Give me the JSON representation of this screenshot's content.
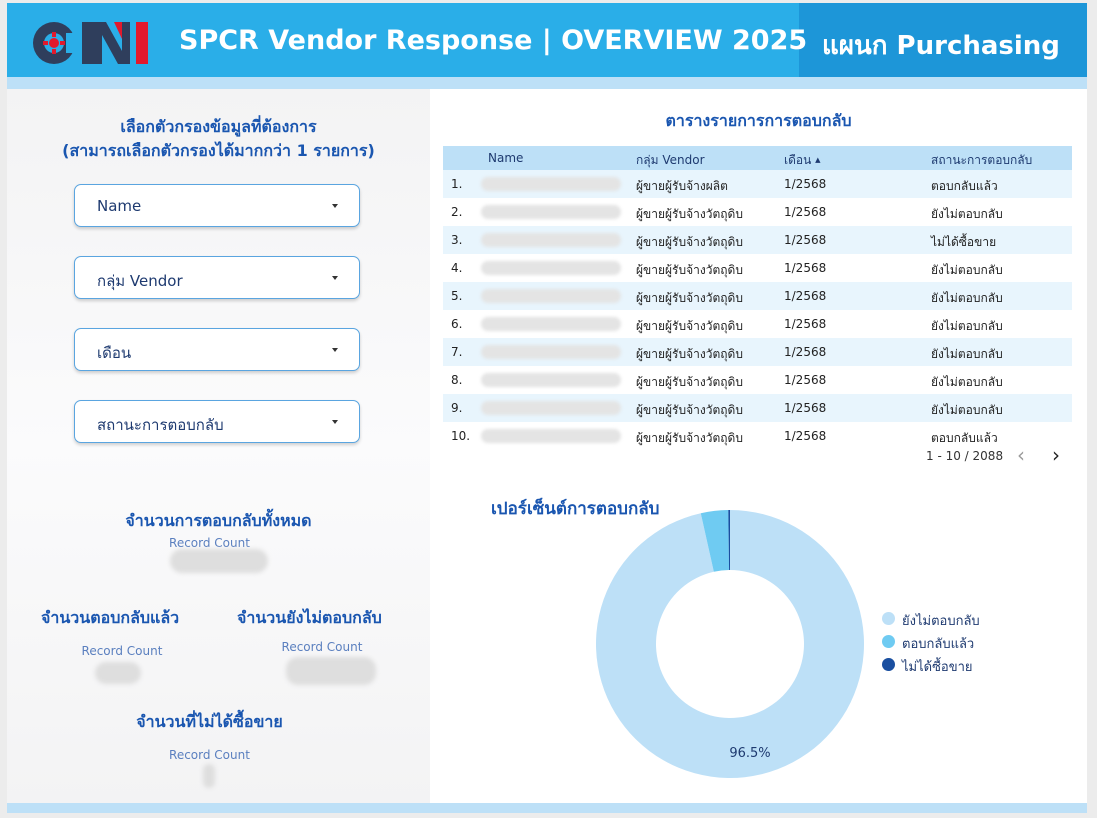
{
  "header": {
    "logo_text": "CNI",
    "title": "SPCR Vendor Response | OVERVIEW 2025",
    "department": "แผนก Purchasing"
  },
  "filters": {
    "title_line1": "เลือกตัวกรองข้อมูลที่ต้องการ",
    "title_line2": "(สามารถเลือกตัวกรองได้มากกว่า 1 รายการ)",
    "items": [
      {
        "label": "Name"
      },
      {
        "label": "กลุ่ม Vendor"
      },
      {
        "label": "เดือน"
      },
      {
        "label": "สถานะการตอบกลับ"
      }
    ]
  },
  "metrics": {
    "total": {
      "title": "จำนวนการตอบกลับทั้งหมด",
      "sub": "Record Count"
    },
    "replied": {
      "title": "จำนวนตอบกลับแล้ว",
      "sub": "Record Count"
    },
    "not_replied": {
      "title": "จำนวนยังไม่ตอบกลับ",
      "sub": "Record Count"
    },
    "not_sold": {
      "title": "จำนวนที่ไม่ได้ซื้อขาย",
      "sub": "Record Count"
    }
  },
  "table": {
    "title": "ตารางรายการการตอบกลับ",
    "columns": [
      "Name",
      "กลุ่ม Vendor",
      "เดือน",
      "สถานะการตอบกลับ"
    ],
    "sort_indicator": "▲",
    "rows": [
      {
        "idx": "1.",
        "group": "ผู้ขายผู้รับจ้างผลิต",
        "month": "1/2568",
        "status": "ตอบกลับแล้ว"
      },
      {
        "idx": "2.",
        "group": "ผู้ขายผู้รับจ้างวัตถุดิบ",
        "month": "1/2568",
        "status": "ยังไม่ตอบกลับ"
      },
      {
        "idx": "3.",
        "group": "ผู้ขายผู้รับจ้างวัตถุดิบ",
        "month": "1/2568",
        "status": "ไม่ได้ซื้อขาย"
      },
      {
        "idx": "4.",
        "group": "ผู้ขายผู้รับจ้างวัตถุดิบ",
        "month": "1/2568",
        "status": "ยังไม่ตอบกลับ"
      },
      {
        "idx": "5.",
        "group": "ผู้ขายผู้รับจ้างวัตถุดิบ",
        "month": "1/2568",
        "status": "ยังไม่ตอบกลับ"
      },
      {
        "idx": "6.",
        "group": "ผู้ขายผู้รับจ้างวัตถุดิบ",
        "month": "1/2568",
        "status": "ยังไม่ตอบกลับ"
      },
      {
        "idx": "7.",
        "group": "ผู้ขายผู้รับจ้างวัตถุดิบ",
        "month": "1/2568",
        "status": "ยังไม่ตอบกลับ"
      },
      {
        "idx": "8.",
        "group": "ผู้ขายผู้รับจ้างวัตถุดิบ",
        "month": "1/2568",
        "status": "ยังไม่ตอบกลับ"
      },
      {
        "idx": "9.",
        "group": "ผู้ขายผู้รับจ้างวัตถุดิบ",
        "month": "1/2568",
        "status": "ยังไม่ตอบกลับ"
      },
      {
        "idx": "10.",
        "group": "ผู้ขายผู้รับจ้างวัตถุดิบ",
        "month": "1/2568",
        "status": "ตอบกลับแล้ว"
      }
    ],
    "pager_text": "1 - 10 / 2088",
    "prev_icon": "chevron-left-icon",
    "next_icon": "chevron-right-icon"
  },
  "chart_data": {
    "type": "pie",
    "title": "เปอร์เซ็นต์การตอบกลับ",
    "categories": [
      "ยังไม่ตอบกลับ",
      "ตอบกลับแล้ว",
      "ไม่ได้ซื้อขาย"
    ],
    "values": [
      96.5,
      3.3,
      0.2
    ],
    "colors": [
      "#bde0f7",
      "#6fcbf2",
      "#1a4fa0"
    ],
    "data_labels": [
      "96.5%"
    ],
    "legend_position": "right"
  }
}
